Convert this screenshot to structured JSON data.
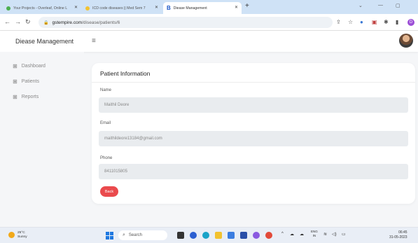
{
  "browser": {
    "tabs": [
      {
        "title": "Your Projects - Overleaf, Online L",
        "active": false
      },
      {
        "title": "ICD code diseases || Med Sem 7",
        "active": false
      },
      {
        "title": "Diease Management",
        "active": true
      }
    ],
    "active_tab_icon": "B",
    "new_tab_label": "+",
    "url_domain": "gstempire.com",
    "url_path": "/disease/patients/6",
    "profile_initial": "D"
  },
  "app": {
    "brand": "Diease Management"
  },
  "sidebar": {
    "items": [
      {
        "label": "Dashboard",
        "icon": "grid-icon"
      },
      {
        "label": "Patients",
        "icon": "grid-icon"
      },
      {
        "label": "Reports",
        "icon": "grid-icon"
      }
    ]
  },
  "card": {
    "title": "Patient Information",
    "fields": [
      {
        "label": "Name",
        "value": "Maithil Deore"
      },
      {
        "label": "Email",
        "value": "maithildeore13184@gmail.com"
      },
      {
        "label": "Phone",
        "value": "8411015805"
      }
    ],
    "back_label": "Back"
  },
  "taskbar": {
    "weather_temp": "25°C",
    "weather_cond": "Sunny",
    "search_placeholder": "Search",
    "lang_top": "ENG",
    "lang_bottom": "IN",
    "time": "06:45",
    "date": "31-05-2023"
  },
  "colors": {
    "accent": "#ea4a4d",
    "tabbar": "#cfe2f6",
    "field_bg": "#e9ecef"
  }
}
